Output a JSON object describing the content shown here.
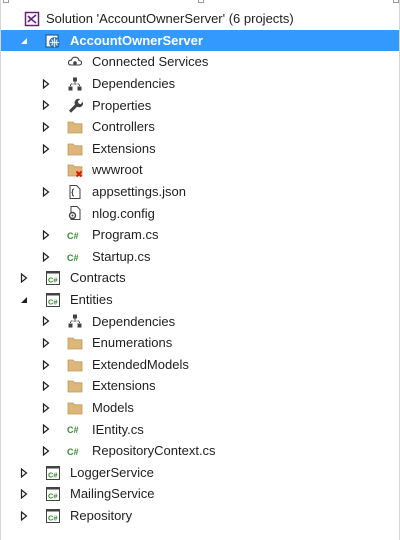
{
  "solution": {
    "label": "Solution 'AccountOwnerServer' (6 projects)",
    "icon": "visual-studio-solution-icon"
  },
  "rows": [
    {
      "label": "AccountOwnerServer",
      "icon": "web-project-icon",
      "expander": "expanded",
      "level": 1,
      "selected": true,
      "name": "project-accountownerserver"
    },
    {
      "label": "Connected Services",
      "icon": "connected-services-icon",
      "expander": "none",
      "level": 2,
      "name": "node-connected-services"
    },
    {
      "label": "Dependencies",
      "icon": "dependencies-icon",
      "expander": "collapsed",
      "level": 2,
      "name": "node-dependencies"
    },
    {
      "label": "Properties",
      "icon": "wrench-icon",
      "expander": "collapsed",
      "level": 2,
      "name": "node-properties"
    },
    {
      "label": "Controllers",
      "icon": "folder-icon",
      "expander": "collapsed",
      "level": 2,
      "name": "folder-controllers"
    },
    {
      "label": "Extensions",
      "icon": "folder-icon",
      "expander": "collapsed",
      "level": 2,
      "name": "folder-extensions"
    },
    {
      "label": "wwwroot",
      "icon": "missing-folder-icon",
      "expander": "none",
      "level": 2,
      "name": "folder-wwwroot"
    },
    {
      "label": "appsettings.json",
      "icon": "json-file-icon",
      "expander": "collapsed",
      "level": 2,
      "name": "file-appsettings-json"
    },
    {
      "label": "nlog.config",
      "icon": "config-file-icon",
      "expander": "none",
      "level": 2,
      "name": "file-nlog-config"
    },
    {
      "label": "Program.cs",
      "icon": "csharp-file-icon",
      "expander": "collapsed",
      "level": 2,
      "name": "file-program-cs"
    },
    {
      "label": "Startup.cs",
      "icon": "csharp-file-icon",
      "expander": "collapsed",
      "level": 2,
      "name": "file-startup-cs"
    },
    {
      "label": "Contracts",
      "icon": "csharp-project-icon",
      "expander": "collapsed",
      "level": 1,
      "name": "project-contracts"
    },
    {
      "label": "Entities",
      "icon": "csharp-project-icon",
      "expander": "expanded",
      "level": 1,
      "name": "project-entities"
    },
    {
      "label": "Dependencies",
      "icon": "dependencies-icon",
      "expander": "collapsed",
      "level": 2,
      "name": "node-entities-dependencies"
    },
    {
      "label": "Enumerations",
      "icon": "folder-icon",
      "expander": "collapsed",
      "level": 2,
      "name": "folder-enumerations"
    },
    {
      "label": "ExtendedModels",
      "icon": "folder-icon",
      "expander": "collapsed",
      "level": 2,
      "name": "folder-extendedmodels"
    },
    {
      "label": "Extensions",
      "icon": "folder-icon",
      "expander": "collapsed",
      "level": 2,
      "name": "folder-entities-extensions"
    },
    {
      "label": "Models",
      "icon": "folder-icon",
      "expander": "collapsed",
      "level": 2,
      "name": "folder-models"
    },
    {
      "label": "IEntity.cs",
      "icon": "csharp-file-icon",
      "expander": "collapsed",
      "level": 2,
      "name": "file-ientity-cs"
    },
    {
      "label": "RepositoryContext.cs",
      "icon": "csharp-file-icon",
      "expander": "collapsed",
      "level": 2,
      "name": "file-repositorycontext-cs"
    },
    {
      "label": "LoggerService",
      "icon": "csharp-project-icon",
      "expander": "collapsed",
      "level": 1,
      "name": "project-loggerservice"
    },
    {
      "label": "MailingService",
      "icon": "csharp-project-icon",
      "expander": "collapsed",
      "level": 1,
      "name": "project-mailingservice"
    },
    {
      "label": "Repository",
      "icon": "csharp-project-icon",
      "expander": "collapsed",
      "level": 1,
      "name": "project-repository"
    }
  ],
  "colors": {
    "selection": "#3399ff",
    "text": "#1e1e1e",
    "folder": "#dcb67a",
    "csharp": "#388a34",
    "error": "#e51400"
  }
}
